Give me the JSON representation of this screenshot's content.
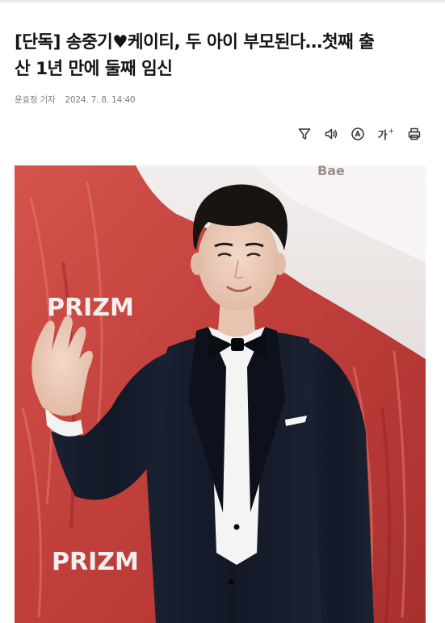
{
  "article": {
    "headline_line1": "[단독] 송중기♥케이티, 두 아이 부모된다…첫째 출",
    "headline_line2": "산 1년 만에 둘째 임신",
    "reporter": "윤효정 기자",
    "date": "2024. 7. 8. 14:40"
  },
  "toolbar": {
    "icons": [
      "filter-icon",
      "speaker-icon",
      "translate-icon",
      "font-size-icon",
      "print-icon"
    ],
    "font_size_label": "가"
  },
  "photo": {
    "backdrop_texts": [
      "PRIZM",
      "PRIZM",
      "Bae"
    ]
  },
  "colors": {
    "headline": "#141414",
    "byline": "#7d7d7d",
    "backdrop_red": "#c9423f",
    "suit": "#141a28"
  }
}
